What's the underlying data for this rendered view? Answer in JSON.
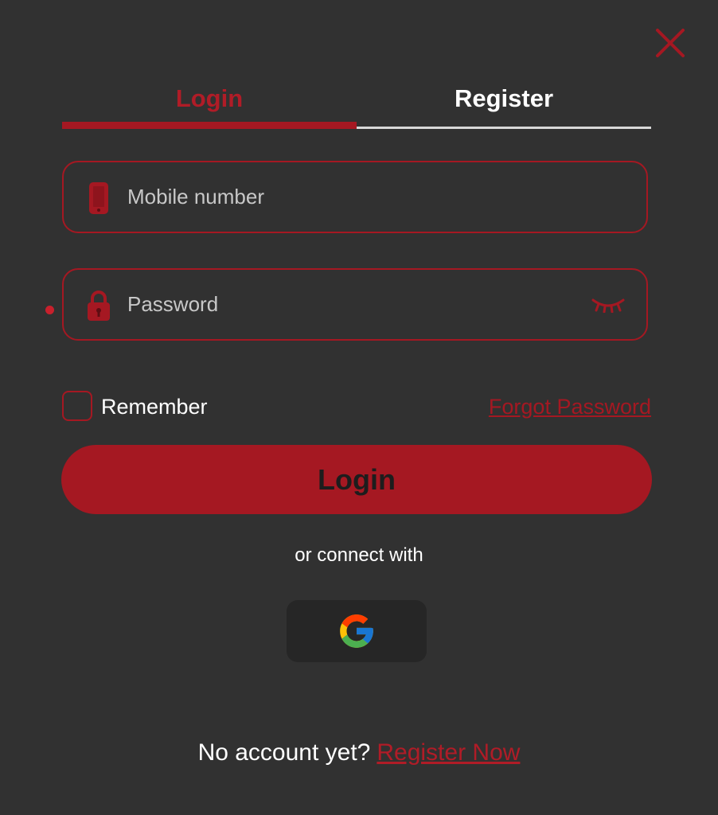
{
  "colors": {
    "background": "#313131",
    "accent": "#a51822",
    "text": "#ffffff",
    "placeholder": "#c8c8c8",
    "social_button_bg": "#262626"
  },
  "header": {
    "close_icon": "close-icon"
  },
  "tabs": [
    {
      "label": "Login",
      "active": true
    },
    {
      "label": "Register",
      "active": false
    }
  ],
  "form": {
    "mobile": {
      "icon": "phone-icon",
      "placeholder": "Mobile number",
      "value": ""
    },
    "password": {
      "icon": "lock-icon",
      "placeholder": "Password",
      "value": "",
      "toggle_icon": "eye-closed-icon"
    },
    "remember": {
      "label": "Remember",
      "checked": false
    },
    "forgot_link": "Forgot Password",
    "submit_label": "Login"
  },
  "social": {
    "divider_text": "or connect with",
    "providers": [
      {
        "name": "google",
        "icon": "google-icon"
      }
    ]
  },
  "footer": {
    "prompt": "No account yet?",
    "link": "Register Now"
  }
}
